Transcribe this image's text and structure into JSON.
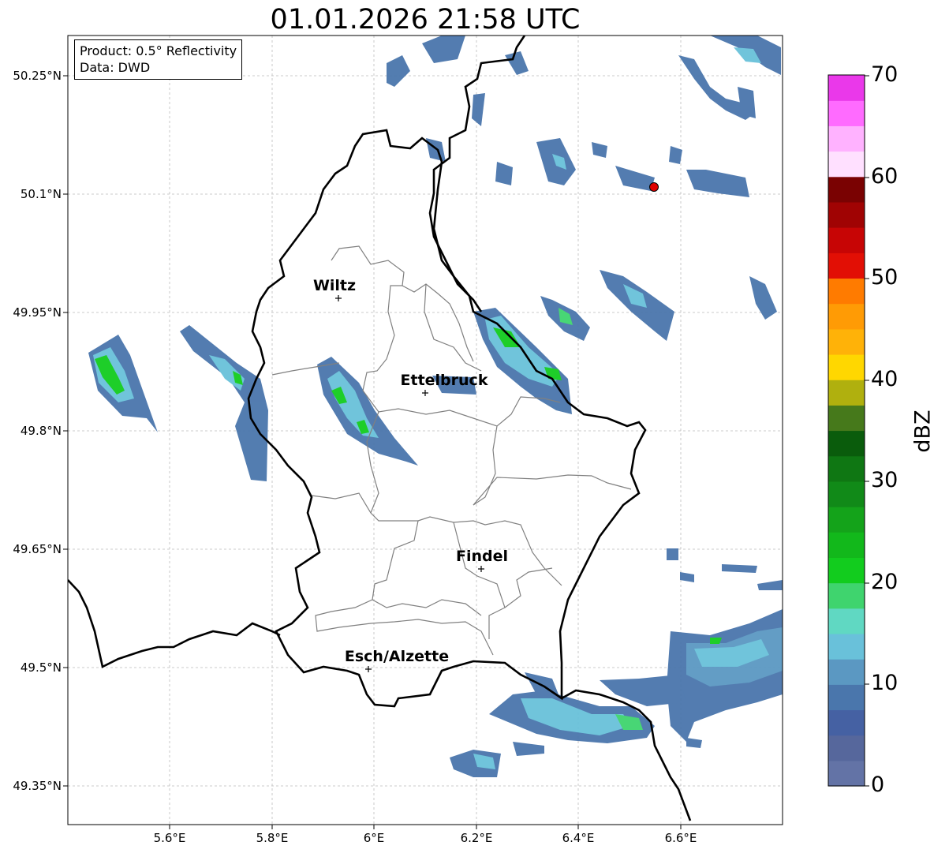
{
  "title": "01.01.2026 21:58 UTC",
  "info": {
    "product": "Product: 0.5° Reflectivity",
    "data": "Data: DWD"
  },
  "lat_labels": [
    "50.25°N",
    "50.1°N",
    "49.95°N",
    "49.8°N",
    "49.65°N",
    "49.5°N",
    "49.35°N"
  ],
  "lon_labels": [
    "5.6°E",
    "5.8°E",
    "6°E",
    "6.2°E",
    "6.4°E",
    "6.6°E"
  ],
  "cities": [
    {
      "name": "Wiltz",
      "lon": 5.93,
      "lat": 49.966
    },
    {
      "name": "Ettelbruck",
      "lon": 6.1,
      "lat": 49.848
    },
    {
      "name": "Findel",
      "lon": 6.21,
      "lat": 49.625
    },
    {
      "name": "Esch/Alzette",
      "lon": 5.99,
      "lat": 49.499
    }
  ],
  "radar_site": {
    "lon": 6.545,
    "lat": 50.11
  },
  "colorbar": {
    "label": "dBZ",
    "ticks": [
      "70",
      "60",
      "50",
      "40",
      "30",
      "20",
      "10",
      "0"
    ],
    "colors": [
      "#6373a6",
      "#56679c",
      "#4561a3",
      "#4a76ac",
      "#5b98c2",
      "#69c1da",
      "#60d8c2",
      "#3fd46e",
      "#12cc1e",
      "#12b81b",
      "#14a31a",
      "#118a18",
      "#0f7713",
      "#0a5c0c",
      "#46791b",
      "#b0b00e",
      "#ffd700",
      "#ffb208",
      "#ff9b05",
      "#ff7b00",
      "#e20f05",
      "#c70505",
      "#a00303",
      "#7a0202",
      "#ffe0ff",
      "#ffb2ff",
      "#ff6bff",
      "#ea38ea"
    ]
  },
  "map_extent": {
    "lon": [
      5.4,
      6.8
    ],
    "lat": [
      49.3,
      50.3
    ]
  },
  "colors": {
    "border": "#000000",
    "canton": "#808080",
    "grid": "#bbbbbb",
    "radar_site": "#e00000"
  }
}
